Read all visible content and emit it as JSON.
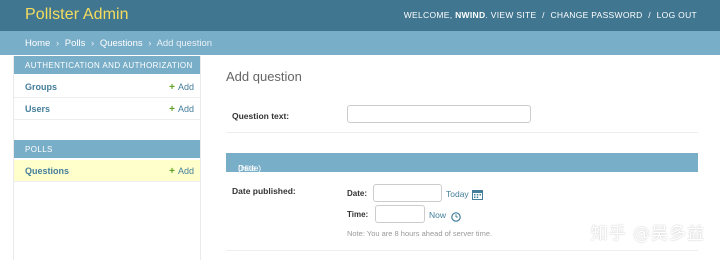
{
  "header": {
    "branding": "Pollster Admin",
    "welcome": "Welcome,",
    "username": "NWIND",
    "links": [
      "View site",
      "Change password",
      "Log out"
    ],
    "colors": {
      "background": "#417690",
      "branding": "#f5dd5d"
    }
  },
  "breadcrumbs": {
    "items": [
      "Home",
      "Polls",
      "Questions"
    ],
    "current": "Add question",
    "separator": "›"
  },
  "sidebar": {
    "modules": [
      {
        "caption": "Authentication and Authorization",
        "models": [
          {
            "name": "Groups",
            "add": "Add"
          },
          {
            "name": "Users",
            "add": "Add"
          }
        ]
      },
      {
        "caption": "Polls",
        "models": [
          {
            "name": "Questions",
            "add": "Add",
            "highlighted": true
          }
        ]
      }
    ]
  },
  "form": {
    "title": "Add question",
    "question_text": {
      "label": "Question text:",
      "value": ""
    },
    "fieldset": {
      "caption": "Date information",
      "toggle": "(Hide)"
    },
    "date_published": {
      "label": "Date published:",
      "date_label": "Date:",
      "date_value": "",
      "today_link": "Today",
      "calendar_icon": "calendar-icon",
      "time_label": "Time:",
      "time_value": "",
      "now_link": "Now",
      "clock_icon": "clock-icon",
      "note": "Note: You are 8 hours ahead of server time."
    }
  },
  "watermark": {
    "text": "知乎 @吴多益"
  }
}
